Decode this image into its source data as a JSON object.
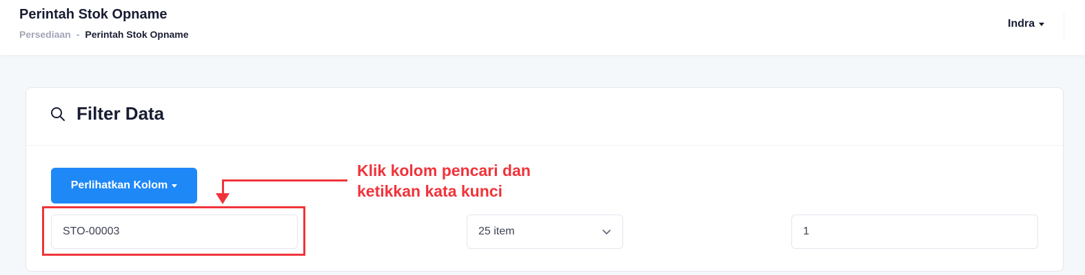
{
  "header": {
    "title": "Perintah Stok Opname",
    "breadcrumb": {
      "parent": "Persediaan",
      "separator": "-",
      "current": "Perintah Stok Opname"
    },
    "user_name": "Indra"
  },
  "filter": {
    "title": "Filter Data",
    "columns_button": "Perlihatkan Kolom",
    "search_value": "STO-00003",
    "page_size": "25 item",
    "page_number": "1"
  },
  "annotation": {
    "line1": "Klik kolom pencari dan",
    "line2": "ketikkan kata kunci"
  },
  "colors": {
    "primary": "#1e88f7",
    "annotation": "#f0333a",
    "background": "#f5f8fa"
  },
  "icons": [
    "search-icon",
    "caret-down-icon",
    "chevron-down-icon"
  ]
}
